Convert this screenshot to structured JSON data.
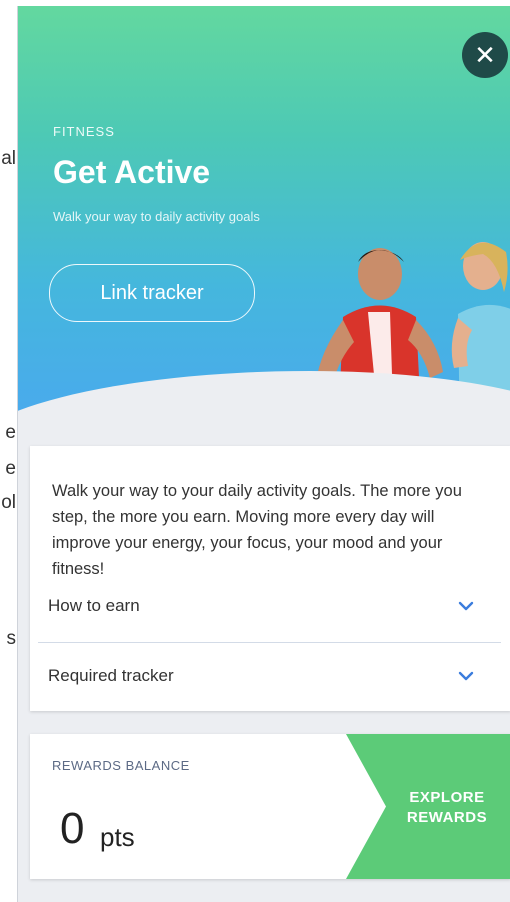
{
  "background_page": {
    "text_fragments": [
      "al",
      "e",
      "e",
      "ol",
      "s"
    ]
  },
  "hero": {
    "category": "FITNESS",
    "title": "Get Active",
    "subtitle": "Walk your way to daily activity goals",
    "link_button": "Link tracker",
    "close_icon": "close-icon"
  },
  "info": {
    "description": "Walk your way to your daily activity goals. The more you step, the more you earn. Moving more every day will improve your energy, your focus, your mood and your fitness!",
    "accordion": [
      {
        "label": "How to earn",
        "icon": "chevron-down-icon"
      },
      {
        "label": "Required tracker",
        "icon": "chevron-down-icon"
      }
    ]
  },
  "rewards": {
    "label": "REWARDS BALANCE",
    "value": "0",
    "unit": "pts",
    "explore_line1": "EXPLORE",
    "explore_line2": "REWARDS"
  },
  "colors": {
    "accent_green": "#5ccb78",
    "chevron_blue": "#3b7ddd",
    "close_bg": "#1f4a48"
  }
}
